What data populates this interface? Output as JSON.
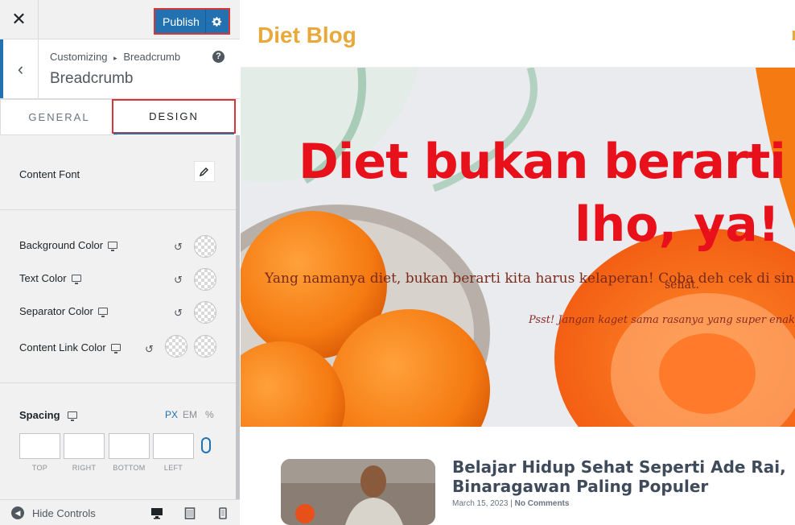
{
  "customizer": {
    "publish_label": "Publish",
    "breadcrumb_parent": "Customizing",
    "breadcrumb_current": "Breadcrumb",
    "section_title": "Breadcrumb",
    "tabs": [
      {
        "label": "GENERAL"
      },
      {
        "label": "DESIGN"
      }
    ],
    "content_font_label": "Content Font",
    "colors": [
      {
        "label": "Background Color"
      },
      {
        "label": "Text Color"
      },
      {
        "label": "Separator Color"
      },
      {
        "label": "Content Link Color"
      }
    ],
    "spacing": {
      "label": "Spacing",
      "units": [
        "PX",
        "EM",
        "%"
      ],
      "active_unit": "PX",
      "fields": [
        {
          "label": "TOP",
          "value": ""
        },
        {
          "label": "RIGHT",
          "value": ""
        },
        {
          "label": "BOTTOM",
          "value": ""
        },
        {
          "label": "LEFT",
          "value": ""
        }
      ]
    },
    "footer": {
      "hide_controls_label": "Hide Controls"
    },
    "accent_color": "#2271b1",
    "highlight_color": "#d63638"
  },
  "preview": {
    "site_title": "Diet Blog",
    "hero": {
      "title_line1": "Diet bukan berarti k",
      "title_line2": "lho, ya!",
      "subtitle": "Yang namanya diet, bukan berarti kita harus kelaperan! Coba deh cek di sin",
      "subtitle_tail": "sehat.",
      "note": "Psst! Jangan kaget sama rasanya yang super enak, ya!"
    },
    "post": {
      "title": "Belajar Hidup Sehat Seperti Ade Rai, Binaragawan Paling Populer",
      "date": "March 15, 2023",
      "comments": "No Comments"
    },
    "title_color": "#e8a93a",
    "hero_text_color": "#e8101a"
  }
}
